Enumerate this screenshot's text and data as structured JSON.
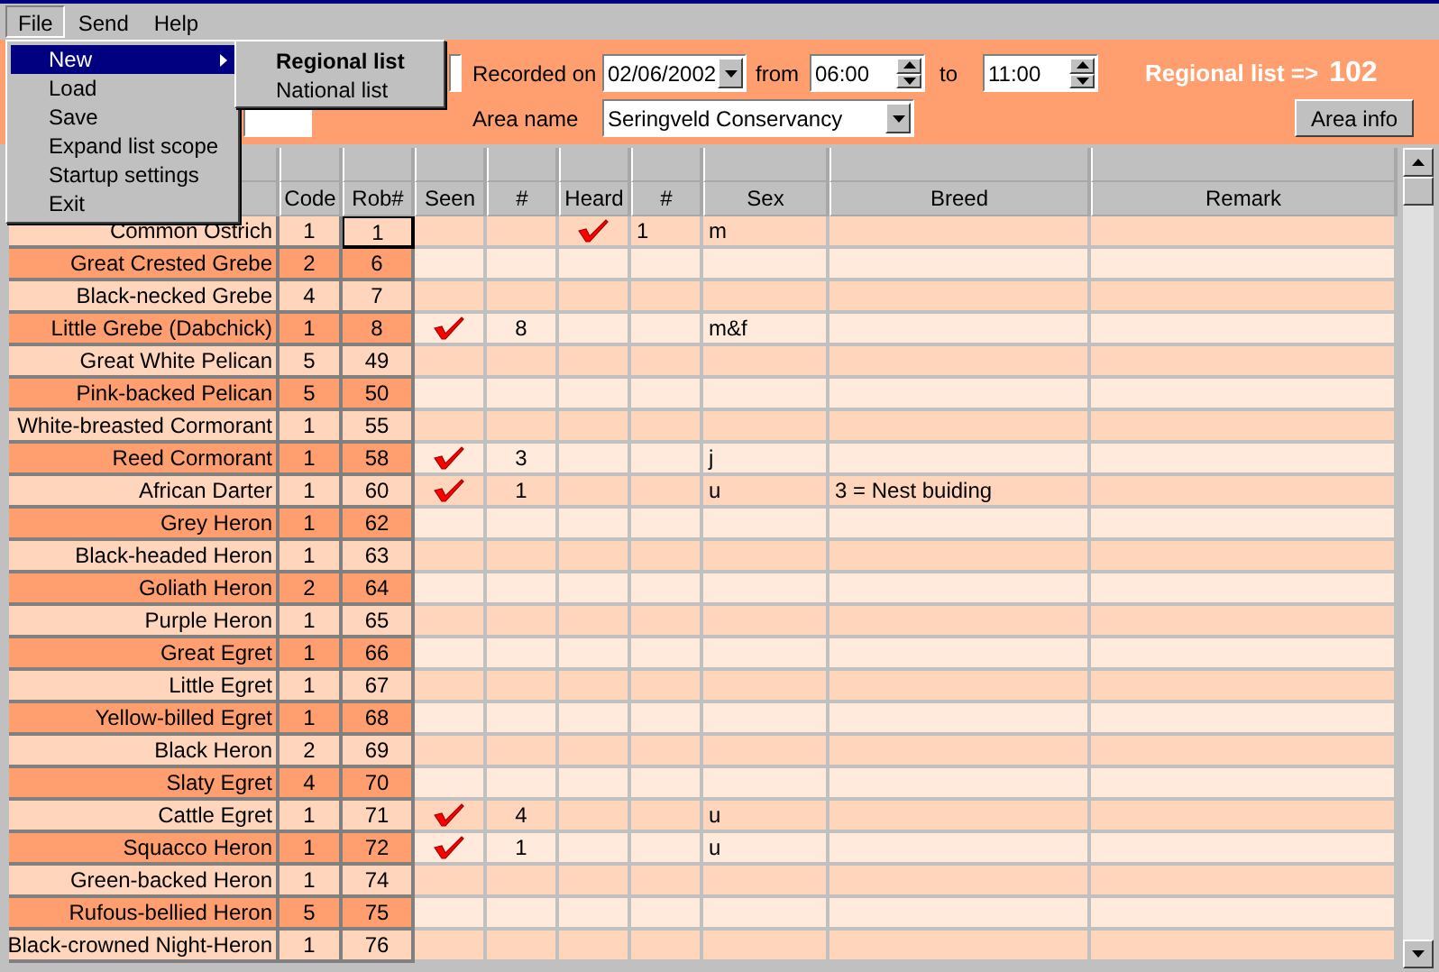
{
  "menu_bar": [
    {
      "label": "File",
      "open": true
    },
    {
      "label": "Send",
      "open": false
    },
    {
      "label": "Help",
      "open": false
    }
  ],
  "file_menu": [
    {
      "label": "New",
      "highlighted": true,
      "has_submenu": true
    },
    {
      "label": "Load",
      "highlighted": false,
      "has_submenu": false
    },
    {
      "label": "Save",
      "highlighted": false,
      "has_submenu": false
    },
    {
      "label": "Expand list scope",
      "highlighted": false,
      "has_submenu": false
    },
    {
      "label": "Startup settings",
      "highlighted": false,
      "has_submenu": false
    },
    {
      "label": "Exit",
      "highlighted": false,
      "has_submenu": false
    }
  ],
  "submenu": [
    {
      "label": "Regional list",
      "default": true
    },
    {
      "label": "National list",
      "default": false
    }
  ],
  "header": {
    "recorded_on_label": "Recorded on",
    "date": "02/06/2002",
    "from_label": "from",
    "from_time": "06:00",
    "to_label": "to",
    "to_time": "11:00",
    "list_title": "Regional list =>",
    "count": "102",
    "area_name_label": "Area name",
    "area_name": "Seringveld Conservancy",
    "area_info_button": "Area info"
  },
  "table": {
    "columns": [
      "Code",
      "Rob#",
      "Seen",
      "#",
      "Heard",
      "#",
      "Sex",
      "Breed",
      "Remark"
    ],
    "rows": [
      {
        "name": "Common Ostrich",
        "code": "1",
        "rob": "1",
        "current": true,
        "seen": false,
        "seen_count": "",
        "heard": true,
        "heard_count": "1",
        "sex": "m",
        "breed": ""
      },
      {
        "name": "Great Crested Grebe",
        "code": "2",
        "rob": "6",
        "current": false,
        "seen": false,
        "seen_count": "",
        "heard": false,
        "heard_count": "",
        "sex": "",
        "breed": ""
      },
      {
        "name": "Black-necked Grebe",
        "code": "4",
        "rob": "7",
        "current": false,
        "seen": false,
        "seen_count": "",
        "heard": false,
        "heard_count": "",
        "sex": "",
        "breed": ""
      },
      {
        "name": "Little Grebe (Dabchick)",
        "code": "1",
        "rob": "8",
        "current": false,
        "seen": true,
        "seen_count": "8",
        "heard": false,
        "heard_count": "",
        "sex": "m&f",
        "breed": ""
      },
      {
        "name": "Great White Pelican",
        "code": "5",
        "rob": "49",
        "current": false,
        "seen": false,
        "seen_count": "",
        "heard": false,
        "heard_count": "",
        "sex": "",
        "breed": ""
      },
      {
        "name": "Pink-backed Pelican",
        "code": "5",
        "rob": "50",
        "current": false,
        "seen": false,
        "seen_count": "",
        "heard": false,
        "heard_count": "",
        "sex": "",
        "breed": ""
      },
      {
        "name": "White-breasted Cormorant",
        "code": "1",
        "rob": "55",
        "current": false,
        "seen": false,
        "seen_count": "",
        "heard": false,
        "heard_count": "",
        "sex": "",
        "breed": ""
      },
      {
        "name": "Reed Cormorant",
        "code": "1",
        "rob": "58",
        "current": false,
        "seen": true,
        "seen_count": "3",
        "heard": false,
        "heard_count": "",
        "sex": "j",
        "breed": ""
      },
      {
        "name": "African Darter",
        "code": "1",
        "rob": "60",
        "current": false,
        "seen": true,
        "seen_count": "1",
        "heard": false,
        "heard_count": "",
        "sex": "u",
        "breed": "3 = Nest buiding"
      },
      {
        "name": "Grey Heron",
        "code": "1",
        "rob": "62",
        "current": false,
        "seen": false,
        "seen_count": "",
        "heard": false,
        "heard_count": "",
        "sex": "",
        "breed": ""
      },
      {
        "name": "Black-headed Heron",
        "code": "1",
        "rob": "63",
        "current": false,
        "seen": false,
        "seen_count": "",
        "heard": false,
        "heard_count": "",
        "sex": "",
        "breed": ""
      },
      {
        "name": "Goliath Heron",
        "code": "2",
        "rob": "64",
        "current": false,
        "seen": false,
        "seen_count": "",
        "heard": false,
        "heard_count": "",
        "sex": "",
        "breed": ""
      },
      {
        "name": "Purple Heron",
        "code": "1",
        "rob": "65",
        "current": false,
        "seen": false,
        "seen_count": "",
        "heard": false,
        "heard_count": "",
        "sex": "",
        "breed": ""
      },
      {
        "name": "Great Egret",
        "code": "1",
        "rob": "66",
        "current": false,
        "seen": false,
        "seen_count": "",
        "heard": false,
        "heard_count": "",
        "sex": "",
        "breed": ""
      },
      {
        "name": "Little Egret",
        "code": "1",
        "rob": "67",
        "current": false,
        "seen": false,
        "seen_count": "",
        "heard": false,
        "heard_count": "",
        "sex": "",
        "breed": ""
      },
      {
        "name": "Yellow-billed Egret",
        "code": "1",
        "rob": "68",
        "current": false,
        "seen": false,
        "seen_count": "",
        "heard": false,
        "heard_count": "",
        "sex": "",
        "breed": ""
      },
      {
        "name": "Black Heron",
        "code": "2",
        "rob": "69",
        "current": false,
        "seen": false,
        "seen_count": "",
        "heard": false,
        "heard_count": "",
        "sex": "",
        "breed": ""
      },
      {
        "name": "Slaty Egret",
        "code": "4",
        "rob": "70",
        "current": false,
        "seen": false,
        "seen_count": "",
        "heard": false,
        "heard_count": "",
        "sex": "",
        "breed": ""
      },
      {
        "name": "Cattle Egret",
        "code": "1",
        "rob": "71",
        "current": false,
        "seen": true,
        "seen_count": "4",
        "heard": false,
        "heard_count": "",
        "sex": "u",
        "breed": ""
      },
      {
        "name": "Squacco Heron",
        "code": "1",
        "rob": "72",
        "current": false,
        "seen": true,
        "seen_count": "1",
        "heard": false,
        "heard_count": "",
        "sex": "u",
        "breed": ""
      },
      {
        "name": "Green-backed Heron",
        "code": "1",
        "rob": "74",
        "current": false,
        "seen": false,
        "seen_count": "",
        "heard": false,
        "heard_count": "",
        "sex": "",
        "breed": ""
      },
      {
        "name": "Rufous-bellied Heron",
        "code": "5",
        "rob": "75",
        "current": false,
        "seen": false,
        "seen_count": "",
        "heard": false,
        "heard_count": "",
        "sex": "",
        "breed": ""
      },
      {
        "name": "Black-crowned Night-Heron",
        "code": "1",
        "rob": "76",
        "current": false,
        "seen": false,
        "seen_count": "",
        "heard": false,
        "heard_count": "",
        "sex": "",
        "breed": ""
      }
    ]
  }
}
